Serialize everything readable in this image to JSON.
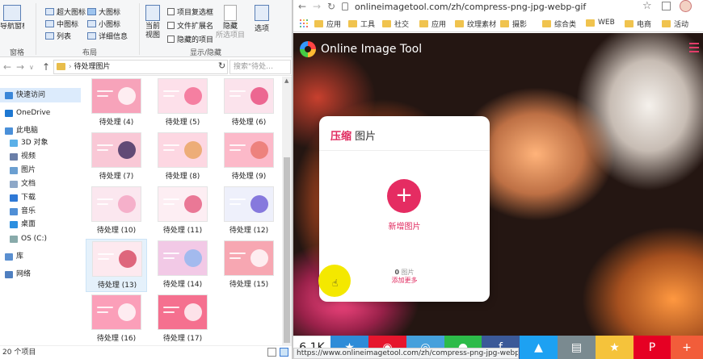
{
  "ribbon": {
    "nav_pane": "导航窗格",
    "layout_options": [
      "超大图标",
      "大图标",
      "中图标",
      "小图标",
      "列表",
      "详细信息"
    ],
    "sort_by": "当前视图",
    "checkboxes": [
      "项目复选框",
      "文件扩展名",
      "隐藏的项目"
    ],
    "hide_selected_line1": "隐藏",
    "hide_selected_line2": "所选项目",
    "options": "选项",
    "group_pane": "窗格",
    "group_layout": "布局",
    "group_show": "显示/隐藏"
  },
  "address": {
    "path": "待处理图片",
    "search_placeholder": "搜索\"待处…"
  },
  "nav_items": [
    {
      "label": "快速访问",
      "icon": "star-icon",
      "color": "#3a86d8"
    },
    {
      "label": "OneDrive",
      "icon": "cloud-icon",
      "color": "#1e78d2"
    },
    {
      "label": "此电脑",
      "icon": "computer-icon",
      "color": "#4a90d9"
    },
    {
      "label": "3D 对象",
      "icon": "cube-icon",
      "color": "#5bb0e8"
    },
    {
      "label": "视频",
      "icon": "video-icon",
      "color": "#6b7fa8"
    },
    {
      "label": "图片",
      "icon": "picture-icon",
      "color": "#6b9fd1"
    },
    {
      "label": "文档",
      "icon": "document-icon",
      "color": "#8ea8c8"
    },
    {
      "label": "下载",
      "icon": "download-icon",
      "color": "#2f79d6"
    },
    {
      "label": "音乐",
      "icon": "music-icon",
      "color": "#4f8fd6"
    },
    {
      "label": "桌面",
      "icon": "desktop-icon",
      "color": "#2c8fe0"
    },
    {
      "label": "OS (C:)",
      "icon": "drive-icon",
      "color": "#8aa"
    },
    {
      "label": "库",
      "icon": "library-icon",
      "color": "#5a8fd0"
    },
    {
      "label": "网络",
      "icon": "network-icon",
      "color": "#4f7fc0"
    }
  ],
  "files": [
    {
      "label": "待处理 (4)",
      "bg": "#f7a3ba",
      "accent": "#ffffff"
    },
    {
      "label": "待处理 (5)",
      "bg": "#fde0ea",
      "accent": "#f2668f"
    },
    {
      "label": "待处理 (6)",
      "bg": "#fbe3ec",
      "accent": "#e8477a"
    },
    {
      "label": "待处理 (7)",
      "bg": "#f9c8d6",
      "accent": "#3b2a5c"
    },
    {
      "label": "待处理 (8)",
      "bg": "#fdd7e2",
      "accent": "#e8a35e"
    },
    {
      "label": "待处理 (9)",
      "bg": "#fcb9c9",
      "accent": "#e9746a"
    },
    {
      "label": "待处理 (10)",
      "bg": "#fbe7ef",
      "accent": "#f4a3c0"
    },
    {
      "label": "待处理 (11)",
      "bg": "#fdeef3",
      "accent": "#e55a7e"
    },
    {
      "label": "待处理 (12)",
      "bg": "#eef0fb",
      "accent": "#6b5bd6"
    },
    {
      "label": "待处理 (13)",
      "bg": "#fde9ef",
      "accent": "#d6455f"
    },
    {
      "label": "待处理 (14)",
      "bg": "#f2c9e6",
      "accent": "#8fb6f0"
    },
    {
      "label": "待处理 (15)",
      "bg": "#f7a7b2",
      "accent": "#ffffff"
    },
    {
      "label": "待处理 (16)",
      "bg": "#fb9fb9",
      "accent": "#ffffff"
    },
    {
      "label": "待处理 (17)",
      "bg": "#f5708f",
      "accent": "#ffffff"
    }
  ],
  "status": {
    "count": "20 个项目"
  },
  "browser": {
    "url": "onlineimagetool.com/zh/compress-png-jpg-webp-gif",
    "bookmarks": [
      "应用",
      "工具",
      "社交",
      "应用",
      "纹理素材",
      "摄影",
      "综合类",
      "WEB",
      "电商",
      "活动"
    ]
  },
  "site": {
    "logo": "Online Image Tool",
    "card_title_accent": "压缩",
    "card_title_rest": " 图片",
    "add_label": "新增图片",
    "count_num": "0",
    "count_unit": " 图片",
    "add_more": "添加更多"
  },
  "share": {
    "count": "6.1K",
    "buttons": [
      {
        "name": "favorite-share-icon",
        "glyph": "★",
        "color": "#2e8cd8"
      },
      {
        "name": "weibo-share-icon",
        "glyph": "◉",
        "color": "#e6162d"
      },
      {
        "name": "qq-share-icon",
        "glyph": "◎",
        "color": "#45a0dc"
      },
      {
        "name": "wechat-share-icon",
        "glyph": "●",
        "color": "#2dbb4a"
      },
      {
        "name": "facebook-share-icon",
        "glyph": "f",
        "color": "#3b5998"
      },
      {
        "name": "twitter-share-icon",
        "glyph": "▲",
        "color": "#1da1f2"
      },
      {
        "name": "print-share-icon",
        "glyph": "▤",
        "color": "#7a8a90"
      },
      {
        "name": "bookmark-share-icon",
        "glyph": "★",
        "color": "#f5c33b"
      },
      {
        "name": "pinterest-share-icon",
        "glyph": "P",
        "color": "#e60023"
      },
      {
        "name": "more-share-icon",
        "glyph": "+",
        "color": "#f25d3a"
      }
    ]
  },
  "hover_url": "https://www.onlineimagetool.com/zh/compress-png-jpg-webp-gif#"
}
